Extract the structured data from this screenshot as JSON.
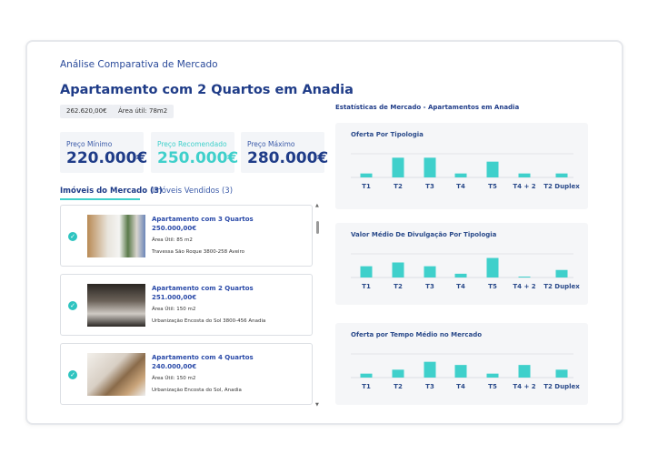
{
  "header": {
    "subtitle": "Análise Comparativa de Mercado",
    "title": "Apartamento com 2 Quartos em Anadia",
    "tags": [
      "262.620,00€",
      "Área útil: 78m2"
    ]
  },
  "prices": [
    {
      "label": "Preço Mínimo",
      "value": "220.000€"
    },
    {
      "label": "Preço Recomendado",
      "value": "250.000€"
    },
    {
      "label": "Preço Máximo",
      "value": "280.000€"
    }
  ],
  "tabs": [
    {
      "label": "Imóveis do Mercado (3)",
      "active": true
    },
    {
      "label": "Imóveis Vendidos (3)",
      "active": false
    }
  ],
  "listings": [
    {
      "title": "Apartamento com 3 Quartos",
      "price": "250.000,00€",
      "area": "Área Útil: 85 m2",
      "address": "Travessa São Roque 3800-258 Aveiro"
    },
    {
      "title": "Apartamento com 2 Quartos",
      "price": "251.000,00€",
      "area": "Área Útil: 150 m2",
      "address": "Urbanização Encosta do Sol 3800-456 Anadia"
    },
    {
      "title": "Apartamento com 4 Quartos",
      "price": "240.000,00€",
      "area": "Área Útil: 150 m2",
      "address": "Urbanização Encosta do Sol, Anadia"
    }
  ],
  "stats_title": "Estatísticas de Mercado - Apartamentos em Anadia",
  "colors": {
    "accent": "#3fd0cb",
    "primary": "#1f3c88"
  },
  "chart_data": [
    {
      "type": "bar",
      "title": "Oferta Por Tipologia",
      "categories": [
        "T1",
        "T2",
        "T3",
        "T4",
        "T5",
        "T4 + 2",
        "T2 Duplex"
      ],
      "values": [
        1,
        5,
        5,
        1,
        4,
        1,
        1
      ],
      "ylim": [
        0,
        6
      ]
    },
    {
      "type": "bar",
      "title": "Valor Médio De Divulgação Por Tipologia",
      "categories": [
        "T1",
        "T2",
        "T3",
        "T4",
        "T5",
        "T4 + 2",
        "T2 Duplex"
      ],
      "values": [
        3,
        4,
        3,
        1,
        5.2,
        0.2,
        2
      ],
      "ylim": [
        0,
        6.3
      ]
    },
    {
      "type": "bar",
      "title": "Oferta por Tempo Médio no Mercado",
      "categories": [
        "T1",
        "T2",
        "T3",
        "T4",
        "T5",
        "T4 + 2",
        "T2 Duplex"
      ],
      "values": [
        1,
        2,
        4,
        3.2,
        1,
        3.2,
        2
      ],
      "ylim": [
        0,
        6
      ]
    }
  ]
}
